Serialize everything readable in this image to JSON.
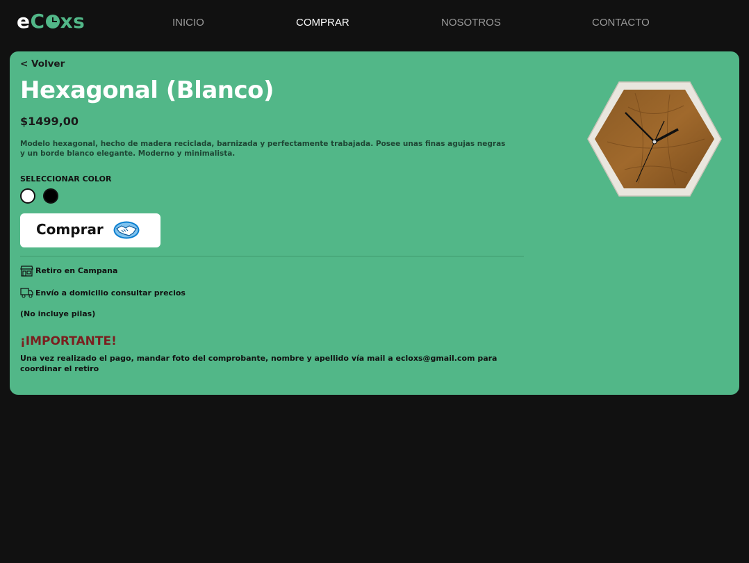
{
  "brand": {
    "logo_first": "e",
    "logo_c": "C",
    "logo_after_clock": "xs"
  },
  "nav": {
    "items": [
      {
        "label": "INICIO"
      },
      {
        "label": "COMPRAR"
      },
      {
        "label": "NOSOTROS"
      },
      {
        "label": "CONTACTO"
      }
    ],
    "active": "COMPRAR"
  },
  "product": {
    "back_label": "< Volver",
    "title": "Hexagonal (Blanco)",
    "price": "$1499,00",
    "description": "Modelo hexagonal, hecho de madera reciclada, barnizada y perfectamente trabajada. Posee unas finas agujas negras y un borde blanco elegante. Moderno y minimalista.",
    "color_label": "SELECCIONAR COLOR",
    "colors": [
      "#ffffff",
      "#000000"
    ],
    "buy_label": "Comprar",
    "pickup": "Retiro en Campana",
    "shipping": "Envío a domicilio consultar precios",
    "note": "(No incluye pilas)",
    "important_title": "¡IMPORTANTE!",
    "important_text": "Una vez realizado el pago, mandar foto del comprobante, nombre y apellido vía mail a ecloxs@gmail.com para coordinar el retiro"
  },
  "icons": {
    "buy": "handshake-icon",
    "pickup": "store-icon",
    "shipping": "truck-icon"
  },
  "colors": {
    "background": "#111111",
    "card": "#52b788",
    "accent": "#52b788",
    "important": "#7a1f1f"
  }
}
